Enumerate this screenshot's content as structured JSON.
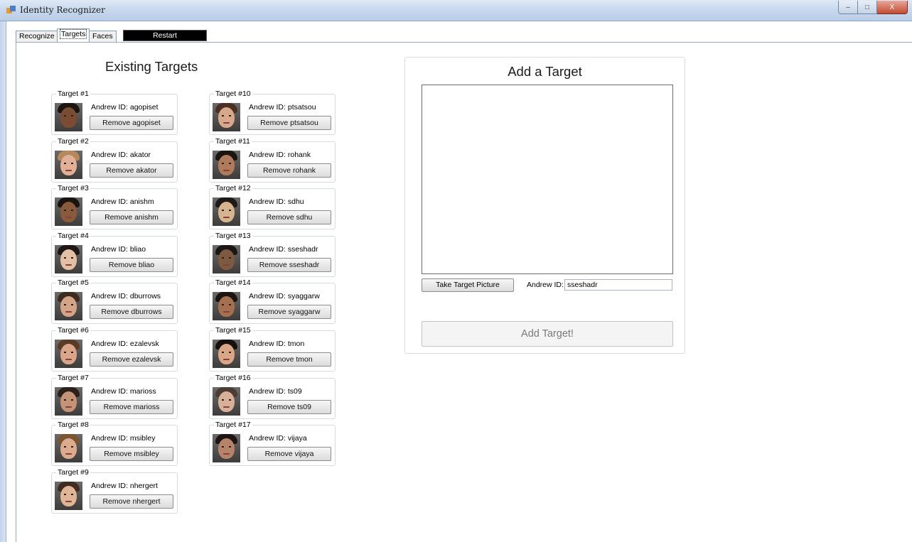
{
  "window": {
    "title": "Identity Recognizer",
    "minimize_icon": "minimize-icon",
    "maximize_icon": "maximize-icon",
    "close_icon": "close-icon",
    "minimize_glyph": "–",
    "maximize_glyph": "□",
    "close_glyph": "X"
  },
  "tabs": [
    {
      "label": "Recognize",
      "active": false
    },
    {
      "label": "Targets",
      "active": true
    },
    {
      "label": "Faces",
      "active": false
    }
  ],
  "restart_label": "Restart",
  "existing_targets": {
    "title": "Existing Targets",
    "targets": [
      {
        "legend": "Target #1",
        "andrew_id_label": "Andrew ID: agopiset",
        "remove_label": "Remove agopiset",
        "skin": "#7a4c33",
        "hair": "#1b1410"
      },
      {
        "legend": "Target #2",
        "andrew_id_label": "Andrew ID: akator",
        "remove_label": "Remove akator",
        "skin": "#e2b096",
        "hair": "#b3895d"
      },
      {
        "legend": "Target #3",
        "andrew_id_label": "Andrew ID: anishm",
        "remove_label": "Remove anishm",
        "skin": "#8a5a3c",
        "hair": "#1a1411"
      },
      {
        "legend": "Target #4",
        "andrew_id_label": "Andrew ID: bliao",
        "remove_label": "Remove bliao",
        "skin": "#e3bfa6",
        "hair": "#1d1715"
      },
      {
        "legend": "Target #5",
        "andrew_id_label": "Andrew ID: dburrows",
        "remove_label": "Remove dburrows",
        "skin": "#d3a487",
        "hair": "#3d2c20"
      },
      {
        "legend": "Target #6",
        "andrew_id_label": "Andrew ID: ezalevsk",
        "remove_label": "Remove ezalevsk",
        "skin": "#d9a689",
        "hair": "#5a3b26"
      },
      {
        "legend": "Target #7",
        "andrew_id_label": "Andrew ID: marioss",
        "remove_label": "Remove marioss",
        "skin": "#c59375",
        "hair": "#2a211c"
      },
      {
        "legend": "Target #8",
        "andrew_id_label": "Andrew ID: msibley",
        "remove_label": "Remove msibley",
        "skin": "#dcab8d",
        "hair": "#7b5434"
      },
      {
        "legend": "Target #9",
        "andrew_id_label": "Andrew ID: nhergert",
        "remove_label": "Remove nhergert",
        "skin": "#e0b595",
        "hair": "#3f2d22"
      },
      {
        "legend": "Target #10",
        "andrew_id_label": "Andrew ID: ptsatsou",
        "remove_label": "Remove ptsatsou",
        "skin": "#d8a88d",
        "hair": "#4a2f22"
      },
      {
        "legend": "Target #11",
        "andrew_id_label": "Andrew ID: rohank",
        "remove_label": "Remove rohank",
        "skin": "#b07b5d",
        "hair": "#1b1512"
      },
      {
        "legend": "Target #12",
        "andrew_id_label": "Andrew ID: sdhu",
        "remove_label": "Remove sdhu",
        "skin": "#d6b48f",
        "hair": "#1d1a17"
      },
      {
        "legend": "Target #13",
        "andrew_id_label": "Andrew ID: sseshadr",
        "remove_label": "Remove sseshadr",
        "skin": "#7d5940",
        "hair": "#1a1613"
      },
      {
        "legend": "Target #14",
        "andrew_id_label": "Andrew ID: syaggarw",
        "remove_label": "Remove syaggarw",
        "skin": "#a5704f",
        "hair": "#1b1512"
      },
      {
        "legend": "Target #15",
        "andrew_id_label": "Andrew ID: tmon",
        "remove_label": "Remove tmon",
        "skin": "#d9a785",
        "hair": "#16110f"
      },
      {
        "legend": "Target #16",
        "andrew_id_label": "Andrew ID: ts09",
        "remove_label": "Remove ts09",
        "skin": "#d8b099",
        "hair": "#4b3d33"
      },
      {
        "legend": "Target #17",
        "andrew_id_label": "Andrew ID: vijaya",
        "remove_label": "Remove vijaya",
        "skin": "#b5836a",
        "hair": "#1c1513"
      }
    ]
  },
  "add_target": {
    "title": "Add a Target",
    "take_picture_label": "Take Target Picture",
    "andrew_id_field_label": "Andrew ID:",
    "andrew_id_value": "sseshadr",
    "add_button_label": "Add Target!"
  }
}
